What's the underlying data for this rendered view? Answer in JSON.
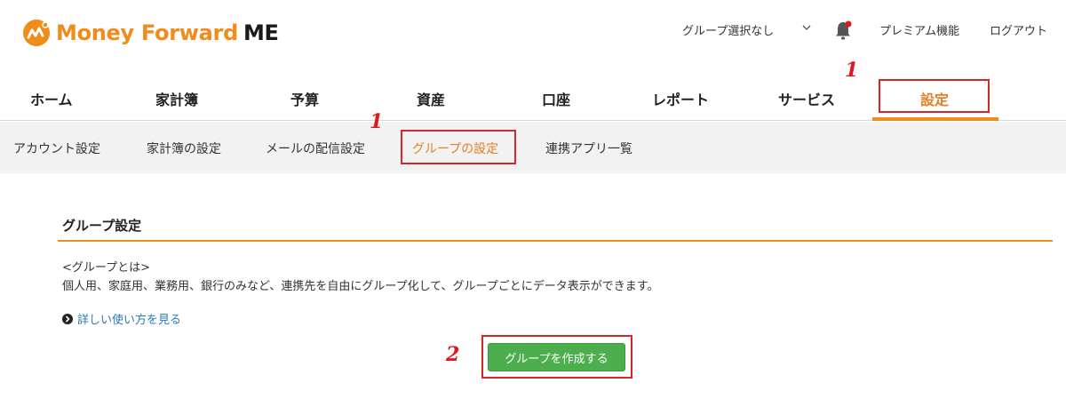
{
  "logo": {
    "name": "Money Forward",
    "suffix": "ME"
  },
  "header": {
    "group_select": "グループ選択なし",
    "premium": "プレミアム機能",
    "logout": "ログアウト"
  },
  "mainnav": {
    "items": [
      "ホーム",
      "家計簿",
      "予算",
      "資産",
      "口座",
      "レポート",
      "サービス",
      "設定"
    ],
    "active_index": 7
  },
  "subnav": {
    "items": [
      "アカウント設定",
      "家計簿の設定",
      "メールの配信設定",
      "グループの設定",
      "連携アプリ一覧"
    ],
    "active_index": 3
  },
  "content": {
    "title": "グループ設定",
    "desc_heading": "<グループとは>",
    "desc_body": "個人用、家庭用、業務用、銀行のみなど、連携先を自由にグループ化して、グループごとにデータ表示ができます。",
    "howto_link": "詳しい使い方を見る",
    "create_button": "グループを作成する"
  },
  "annotations": {
    "step1": "1",
    "step2": "2"
  },
  "colors": {
    "brand_orange": "#f08c1c",
    "button_green": "#4cae4c",
    "annotation_red": "#d6262b",
    "link_blue": "#2a7ab8"
  }
}
